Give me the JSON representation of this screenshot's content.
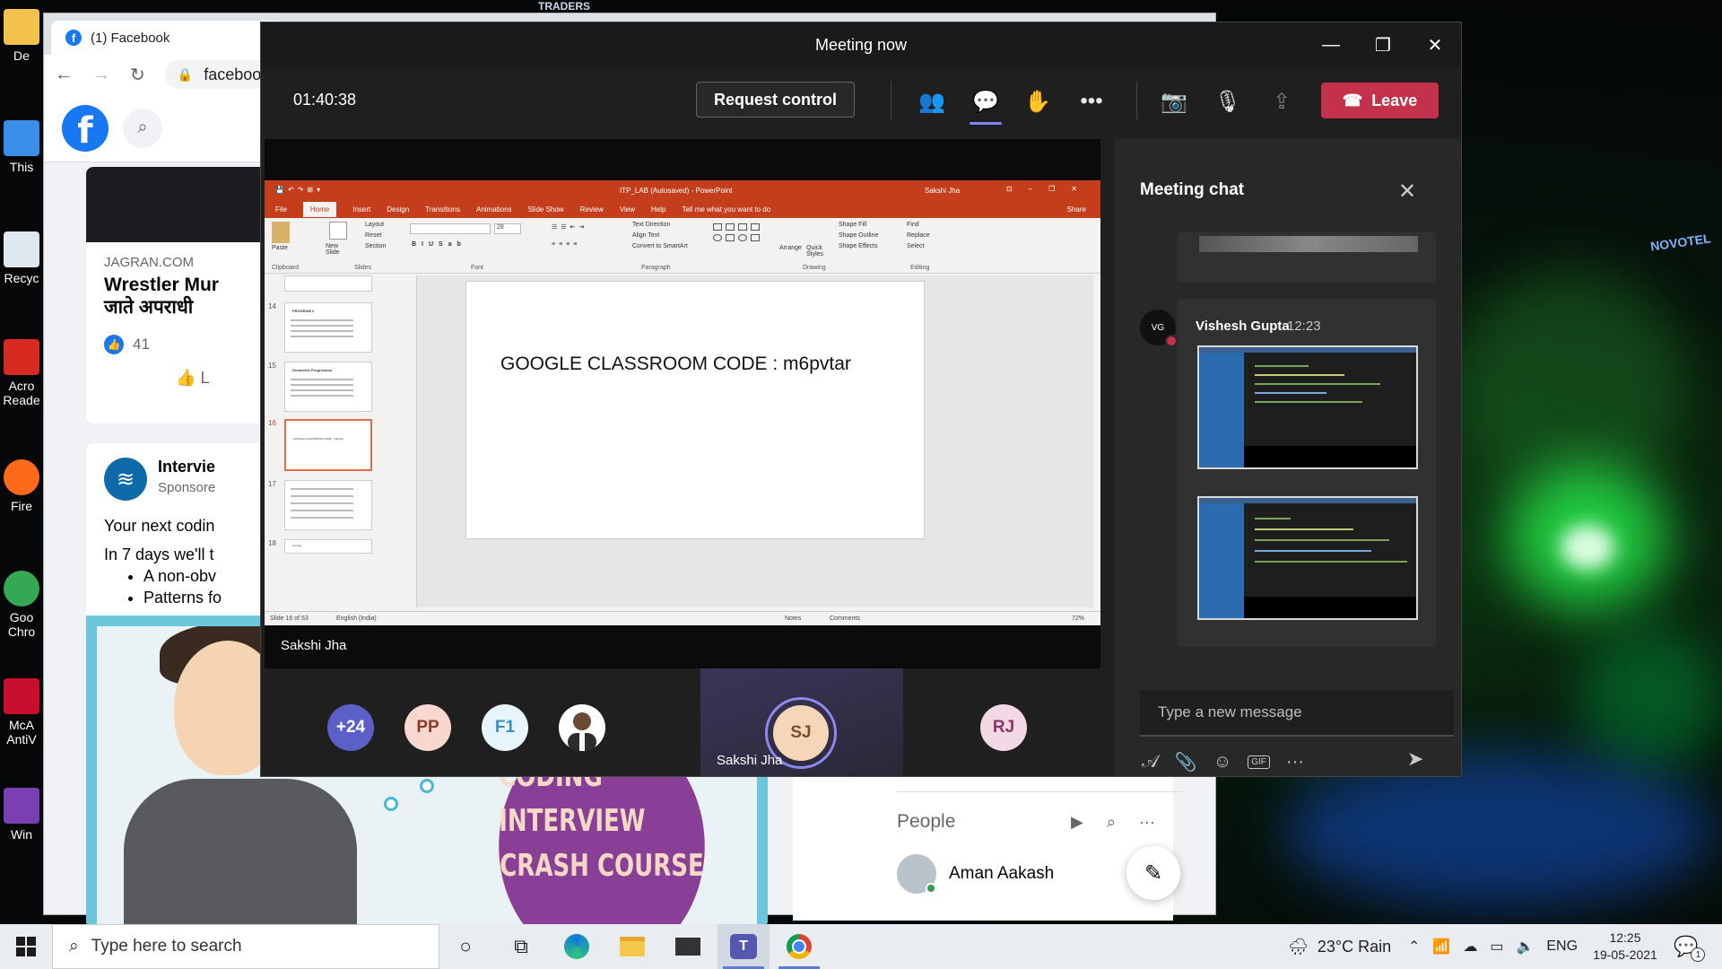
{
  "desktop": {
    "icons": [
      {
        "label": "De",
        "color": "#f2c24d"
      },
      {
        "label": "This",
        "color": "#3a8ee6"
      },
      {
        "label": "Recyc",
        "color": "#dfe7ef"
      },
      {
        "label": "Acro Reade",
        "color": "#d62b20"
      },
      {
        "label": "Fire",
        "color": "#ff6a1a"
      },
      {
        "label": "Goo Chro",
        "color": "#34a853"
      },
      {
        "label": "McA AntiV",
        "color": "#c8102e"
      },
      {
        "label": "Win",
        "color": "#7a3fb2"
      }
    ],
    "sign_text": "TRADERS",
    "hotel_text": "NOVOTEL"
  },
  "chrome": {
    "tab_title": "(1) Facebook",
    "url": "faceboo",
    "fb_logo": "f",
    "post1": {
      "source": "JAGRAN.COM",
      "headline_line1": "Wrestler Mur",
      "headline_line2": "जाते अपराधी",
      "likes": "41",
      "like_label": "L"
    },
    "post2": {
      "advertiser": "Intervie",
      "sponsored": "Sponsore",
      "line1": "Your next codin",
      "line2": "In 7 days we'll t",
      "bullets": [
        "A non-obv",
        "Patterns fo"
      ],
      "badge_line1": "CODING INTERVIEW",
      "badge_line2": "CRASH COURSE"
    },
    "people": {
      "title": "People",
      "contact": "Aman Aakash"
    }
  },
  "teams": {
    "window_title": "Meeting now",
    "timer": "01:40:38",
    "request_control": "Request control",
    "leave": "Leave",
    "presenter": "Sakshi Jha",
    "ppt": {
      "title": "ITP_LAB (Autosaved)  -  PowerPoint",
      "user": "Sakshi Jha",
      "tabs": [
        "File",
        "Home",
        "Insert",
        "Design",
        "Transitions",
        "Animations",
        "Slide Show",
        "Review",
        "View",
        "Help",
        "Tell me what you want to do"
      ],
      "share": "Share",
      "groups": [
        "Clipboard",
        "Slides",
        "Font",
        "Paragraph",
        "Drawing",
        "Editing"
      ],
      "ribbon_items": {
        "paste": "Paste",
        "new_slide": "New Slide",
        "layout": "Layout",
        "reset": "Reset",
        "section": "Section",
        "font_size": "28",
        "text_direction": "Text Direction",
        "align_text": "Align Text",
        "convert": "Convert to SmartArt",
        "arrange": "Arrange",
        "quick_styles": "Quick Styles",
        "shape_fill": "Shape Fill",
        "shape_outline": "Shape Outline",
        "shape_effects": "Shape Effects",
        "find": "Find",
        "replace": "Replace",
        "select": "Select"
      },
      "thumb_numbers": [
        "14",
        "15",
        "16",
        "17",
        "18"
      ],
      "thumb_texts": [
        "PROGRAM 2",
        "Geometric Progression",
        "GOOGLE CLASSROOM CODE : m6pvtar",
        "",
        "for loop"
      ],
      "slide_text": "GOOGLE CLASSROOM CODE : m6pvtar",
      "status_slide": "Slide 16 of 53",
      "status_lang": "English (India)",
      "status_notes": "Notes",
      "status_comments": "Comments",
      "status_zoom": "72%"
    },
    "participants": [
      {
        "initials": "+24",
        "bg": "#5b5fc7",
        "fg": "#ffffff"
      },
      {
        "initials": "PP",
        "bg": "#f8d7cf",
        "fg": "#8a3b2a"
      },
      {
        "initials": "F1",
        "bg": "#e8f4fb",
        "fg": "#3a8ec8"
      },
      {
        "initials": "",
        "bg": "#ffffff",
        "fg": "#333333"
      },
      {
        "initials": "RJ",
        "bg": "#f3d8e6",
        "fg": "#8a3566"
      }
    ],
    "active_speaker": {
      "initials": "SJ",
      "name": "Sakshi Jha"
    },
    "chat": {
      "title": "Meeting chat",
      "author": "Vishesh Gupta",
      "time": "12:23",
      "avatar_initials": "VG",
      "input_placeholder": "Type a new message"
    }
  },
  "taskbar": {
    "search_placeholder": "Type here to search",
    "weather": "23°C  Rain",
    "language": "ENG",
    "time": "12:25",
    "date": "19-05-2021",
    "notifications": "1"
  }
}
